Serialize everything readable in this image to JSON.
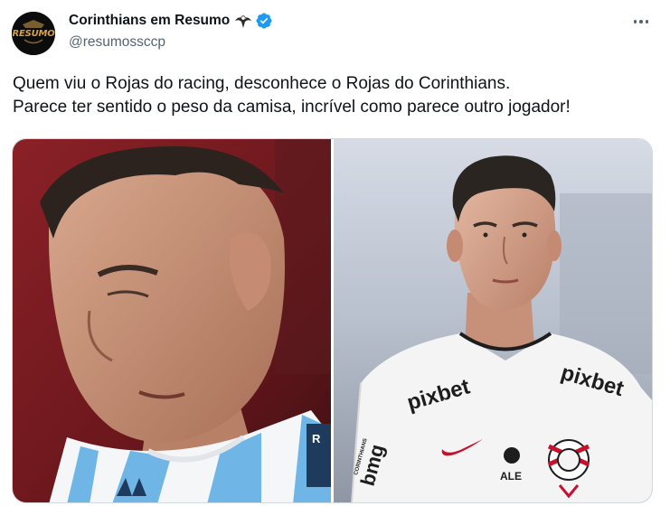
{
  "author": {
    "display_name": "Corinthians em Resumo",
    "handle": "@resumossccp",
    "avatar_text": "RESUMO",
    "badges": [
      "eagle-emoji",
      "verified-badge"
    ],
    "verified_color": "#1d9bf0"
  },
  "more_menu": {
    "icon": "more-horizontal-icon"
  },
  "tweet": {
    "line_1": "Quem viu o Rojas do racing, desconhece o Rojas do Corinthians.",
    "line_2": "Parece ter sentido o peso da camisa, incrível como parece outro jogador!"
  },
  "media": [
    {
      "description_kind": "photo",
      "shirt_label": "R",
      "colors": {
        "background": "#7a1e22",
        "stripe_blue": "#6fb6e6",
        "stripe_white": "#f4f6f8"
      }
    },
    {
      "description_kind": "photo",
      "sponsor_1": "pixbet",
      "sponsor_2": "pixbet",
      "sleeve_sponsor": "bmg",
      "sleeve_sponsor_prefix": "CORINTHIANS",
      "chest_brand": "ALE",
      "colors": {
        "background": "#c4ccd8",
        "shirt": "#f4f4f4",
        "print": "#1d1d1d"
      }
    }
  ]
}
